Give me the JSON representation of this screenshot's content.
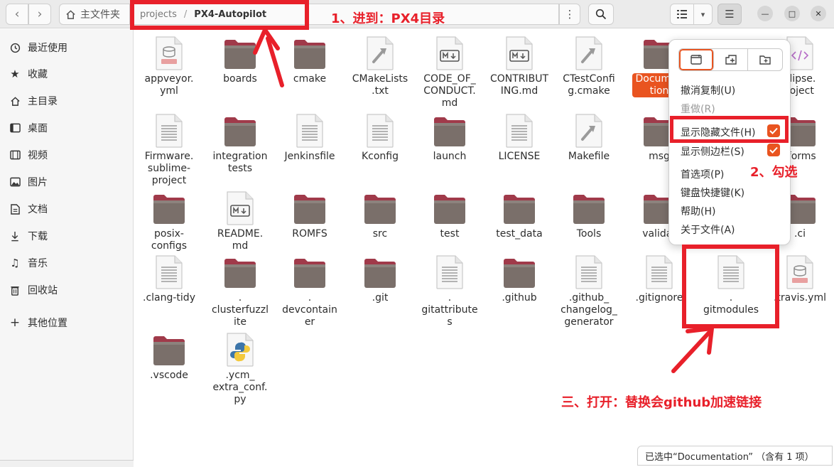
{
  "path": {
    "home": "主文件夹",
    "segment": "projects",
    "sep": "/",
    "current": "PX4-Autopilot"
  },
  "sidebar": [
    {
      "label": "最近使用",
      "icon": "clock-icon"
    },
    {
      "label": "收藏",
      "icon": "star-icon"
    },
    {
      "label": "主目录",
      "icon": "home-icon"
    },
    {
      "label": "桌面",
      "icon": "desktop-icon"
    },
    {
      "label": "视频",
      "icon": "video-icon"
    },
    {
      "label": "图片",
      "icon": "picture-icon"
    },
    {
      "label": "文档",
      "icon": "document-icon"
    },
    {
      "label": "下载",
      "icon": "download-icon"
    },
    {
      "label": "音乐",
      "icon": "music-icon"
    },
    {
      "label": "回收站",
      "icon": "trash-icon"
    },
    {
      "label": "其他位置",
      "icon": "plus-icon"
    }
  ],
  "files": [
    {
      "name": "appveyor.\nyml",
      "type": "yaml"
    },
    {
      "name": "boards",
      "type": "folder"
    },
    {
      "name": "cmake",
      "type": "folder"
    },
    {
      "name": "CMakeLists\n.txt",
      "type": "script"
    },
    {
      "name": "CODE_OF_\nCONDUCT.\nmd",
      "type": "markdown"
    },
    {
      "name": "CONTRIBUT\nING.md",
      "type": "markdown"
    },
    {
      "name": "CTestConfi\ng.cmake",
      "type": "script"
    },
    {
      "name": "Documen\ntion",
      "type": "folder",
      "selected": true
    },
    {
      "name": "",
      "type": "hidden"
    },
    {
      "name": "clipse.\nroject",
      "type": "code"
    },
    {
      "name": "Firmware.\nsublime-\nproject",
      "type": "text"
    },
    {
      "name": "integration\ntests",
      "type": "folder"
    },
    {
      "name": "Jenkinsfile",
      "type": "text"
    },
    {
      "name": "Kconfig",
      "type": "text"
    },
    {
      "name": "launch",
      "type": "folder"
    },
    {
      "name": "LICENSE",
      "type": "text"
    },
    {
      "name": "Makefile",
      "type": "script"
    },
    {
      "name": "msg",
      "type": "folder"
    },
    {
      "name": "",
      "type": "hidden"
    },
    {
      "name": "tforms",
      "type": "folder"
    },
    {
      "name": "posix-\nconfigs",
      "type": "folder"
    },
    {
      "name": "README.\nmd",
      "type": "markdown"
    },
    {
      "name": "ROMFS",
      "type": "folder"
    },
    {
      "name": "src",
      "type": "folder"
    },
    {
      "name": "test",
      "type": "folder"
    },
    {
      "name": "test_data",
      "type": "folder"
    },
    {
      "name": "Tools",
      "type": "folder"
    },
    {
      "name": "validat",
      "type": "folder"
    },
    {
      "name": "",
      "type": "hidden"
    },
    {
      "name": ".ci",
      "type": "folder"
    },
    {
      "name": ".clang-tidy",
      "type": "text"
    },
    {
      "name": ".\nclusterfuzzl\nite",
      "type": "folder"
    },
    {
      "name": ".\ndevcontain\ner",
      "type": "folder"
    },
    {
      "name": ".git",
      "type": "folder"
    },
    {
      "name": ".\ngitattribute\ns",
      "type": "text"
    },
    {
      "name": ".github",
      "type": "folder"
    },
    {
      "name": ".github_\nchangelog_\ngenerator",
      "type": "text"
    },
    {
      "name": ".gitignore",
      "type": "text"
    },
    {
      "name": ".\ngitmodules",
      "type": "text"
    },
    {
      "name": ".travis.yml",
      "type": "yaml"
    },
    {
      "name": ".vscode",
      "type": "folder"
    },
    {
      "name": ".ycm_\nextra_conf.\npy",
      "type": "python"
    }
  ],
  "menu": {
    "items": [
      {
        "label": "撤消复制(U)",
        "dim": false,
        "check": false
      },
      {
        "label": "重做(R)",
        "dim": true,
        "check": false
      },
      {
        "label": "显示隐藏文件(H)",
        "dim": false,
        "check": true
      },
      {
        "label": "显示侧边栏(S)",
        "dim": false,
        "check": true
      },
      {
        "label": "首选项(P)",
        "dim": false,
        "check": false
      },
      {
        "label": "键盘快捷键(K)",
        "dim": false,
        "check": false
      },
      {
        "label": "帮助(H)",
        "dim": false,
        "check": false
      },
      {
        "label": "关于文件(A)",
        "dim": false,
        "check": false
      }
    ]
  },
  "status": "已选中“Documentation” （含有 1 项）",
  "annotations": {
    "step1": "1、进到：PX4目录",
    "step2": "2、勾选",
    "step3": "三、打开：替换会github加速链接"
  },
  "colors": {
    "accent": "#e95420",
    "annotation": "#e8202a",
    "folder_body": "#7a6f6a",
    "folder_tab": "#a03a4a"
  }
}
